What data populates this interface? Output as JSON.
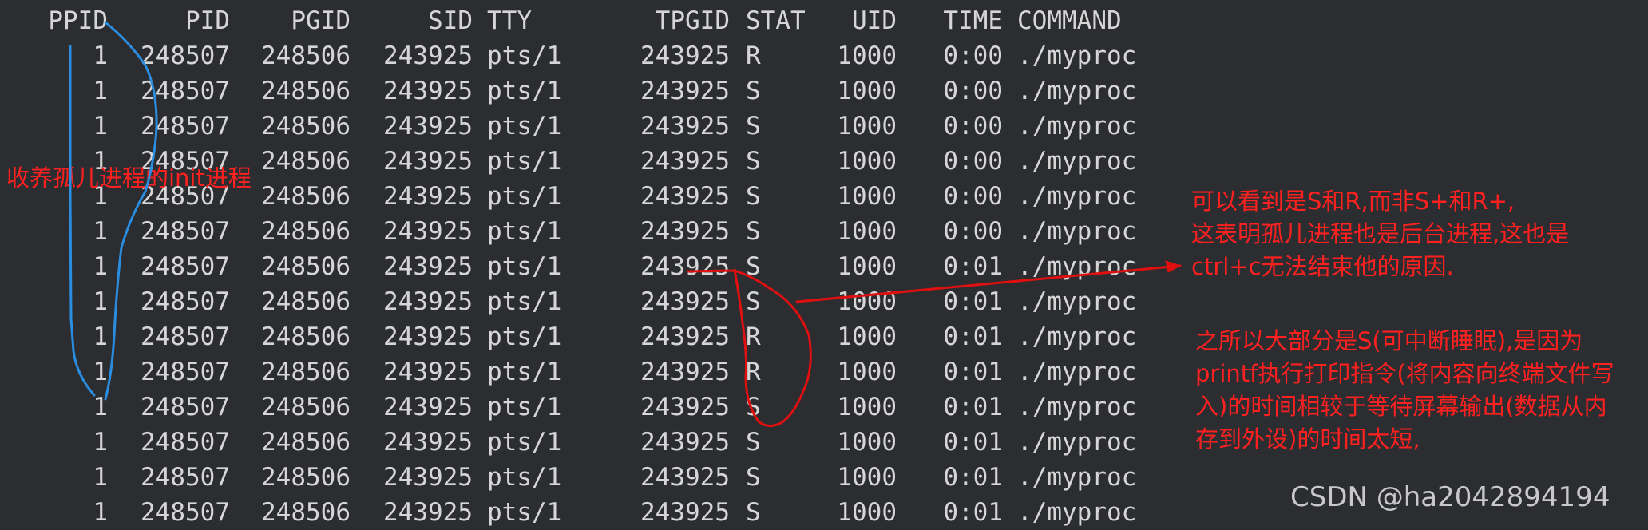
{
  "terminal": {
    "columns": [
      "PPID",
      "PID",
      "PGID",
      "SID",
      "TTY",
      "TPGID",
      "STAT",
      "UID",
      "TIME",
      "COMMAND"
    ],
    "rows": [
      {
        "ppid": "1",
        "pid": "248507",
        "pgid": "248506",
        "sid": "243925",
        "tty": "pts/1",
        "tpgid": "243925",
        "stat": "R",
        "uid": "1000",
        "time": "0:00",
        "command": "./myproc"
      },
      {
        "ppid": "1",
        "pid": "248507",
        "pgid": "248506",
        "sid": "243925",
        "tty": "pts/1",
        "tpgid": "243925",
        "stat": "S",
        "uid": "1000",
        "time": "0:00",
        "command": "./myproc"
      },
      {
        "ppid": "1",
        "pid": "248507",
        "pgid": "248506",
        "sid": "243925",
        "tty": "pts/1",
        "tpgid": "243925",
        "stat": "S",
        "uid": "1000",
        "time": "0:00",
        "command": "./myproc"
      },
      {
        "ppid": "1",
        "pid": "248507",
        "pgid": "248506",
        "sid": "243925",
        "tty": "pts/1",
        "tpgid": "243925",
        "stat": "S",
        "uid": "1000",
        "time": "0:00",
        "command": "./myproc"
      },
      {
        "ppid": "1",
        "pid": "248507",
        "pgid": "248506",
        "sid": "243925",
        "tty": "pts/1",
        "tpgid": "243925",
        "stat": "S",
        "uid": "1000",
        "time": "0:00",
        "command": "./myproc"
      },
      {
        "ppid": "1",
        "pid": "248507",
        "pgid": "248506",
        "sid": "243925",
        "tty": "pts/1",
        "tpgid": "243925",
        "stat": "S",
        "uid": "1000",
        "time": "0:00",
        "command": "./myproc"
      },
      {
        "ppid": "1",
        "pid": "248507",
        "pgid": "248506",
        "sid": "243925",
        "tty": "pts/1",
        "tpgid": "243925",
        "stat": "S",
        "uid": "1000",
        "time": "0:01",
        "command": "./myproc"
      },
      {
        "ppid": "1",
        "pid": "248507",
        "pgid": "248506",
        "sid": "243925",
        "tty": "pts/1",
        "tpgid": "243925",
        "stat": "S",
        "uid": "1000",
        "time": "0:01",
        "command": "./myproc"
      },
      {
        "ppid": "1",
        "pid": "248507",
        "pgid": "248506",
        "sid": "243925",
        "tty": "pts/1",
        "tpgid": "243925",
        "stat": "R",
        "uid": "1000",
        "time": "0:01",
        "command": "./myproc"
      },
      {
        "ppid": "1",
        "pid": "248507",
        "pgid": "248506",
        "sid": "243925",
        "tty": "pts/1",
        "tpgid": "243925",
        "stat": "R",
        "uid": "1000",
        "time": "0:01",
        "command": "./myproc"
      },
      {
        "ppid": "1",
        "pid": "248507",
        "pgid": "248506",
        "sid": "243925",
        "tty": "pts/1",
        "tpgid": "243925",
        "stat": "S",
        "uid": "1000",
        "time": "0:01",
        "command": "./myproc"
      },
      {
        "ppid": "1",
        "pid": "248507",
        "pgid": "248506",
        "sid": "243925",
        "tty": "pts/1",
        "tpgid": "243925",
        "stat": "S",
        "uid": "1000",
        "time": "0:01",
        "command": "./myproc"
      },
      {
        "ppid": "1",
        "pid": "248507",
        "pgid": "248506",
        "sid": "243925",
        "tty": "pts/1",
        "tpgid": "243925",
        "stat": "S",
        "uid": "1000",
        "time": "0:01",
        "command": "./myproc"
      },
      {
        "ppid": "1",
        "pid": "248507",
        "pgid": "248506",
        "sid": "243925",
        "tty": "pts/1",
        "tpgid": "243925",
        "stat": "S",
        "uid": "1000",
        "time": "0:01",
        "command": "./myproc"
      }
    ]
  },
  "annotations": {
    "init_note": "收养孤儿进程的init进程",
    "orphan_note": "可以看到是S和R,而非S+和R+,\n这表明孤儿进程也是后台进程,这也是\nctrl+c无法结束他的原因.",
    "sleep_note": "之所以大部分是S(可中断睡眠),是因为\nprintf执行打印指令(将内容向终端文件写\n入)的时间相较于等待屏幕输出(数据从内\n存到外设)的时间太短,"
  },
  "watermark": "CSDN @ha2042894194",
  "colors": {
    "background": "#2b2d31",
    "terminal_text": "#d6d6d6",
    "annotation_red": "#ff2020",
    "pen_blue": "#2a8de0",
    "pen_red": "#e01010"
  }
}
